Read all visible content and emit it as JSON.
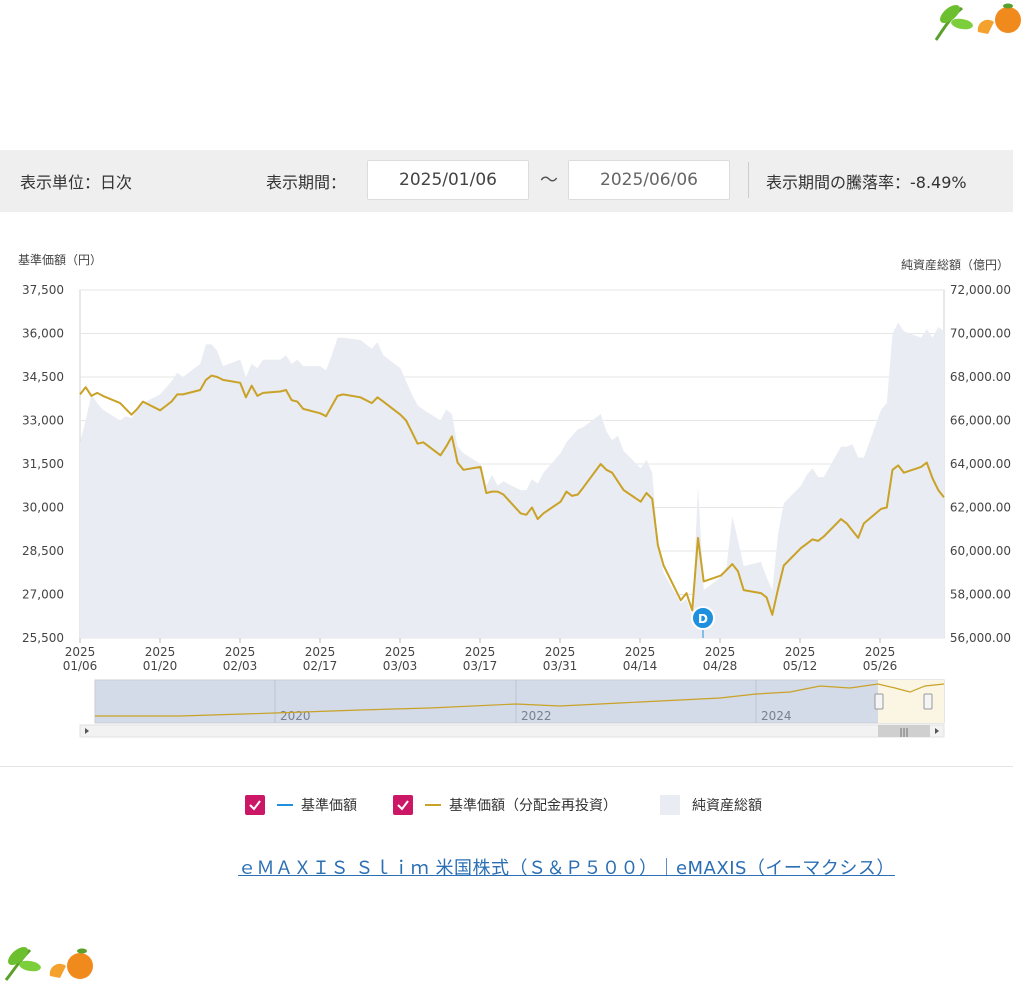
{
  "filter": {
    "unit_label": "表示単位：日次",
    "period_label": "表示期間：",
    "start_date": "2025/01/06",
    "tilde": "～",
    "end_date": "2025/06/06",
    "change_label": "表示期間の騰落率：-8.49%"
  },
  "legend": {
    "item1": "基準価額",
    "item2": "基準価額（分配金再投資）",
    "item3": "純資産総額"
  },
  "footer_link": "ｅＭＡＸＩＳ Ｓｌｉｍ 米国株式（Ｓ＆Ｐ５００）｜eMAXIS（イーマクシス）",
  "chart_data": {
    "type": "line",
    "left_axis": {
      "title": "基準価額（円）",
      "range": [
        25500,
        37500
      ],
      "ticks": [
        "37,500",
        "36,000",
        "34,500",
        "33,000",
        "31,500",
        "30,000",
        "28,500",
        "27,000",
        "25,500"
      ]
    },
    "right_axis": {
      "title": "純資産総額（億円）",
      "range": [
        56000,
        72000
      ],
      "ticks": [
        "72,000.00",
        "70,000.00",
        "68,000.00",
        "66,000.00",
        "64,000.00",
        "62,000.00",
        "60,000.00",
        "58,000.00",
        "56,000.00"
      ]
    },
    "x_ticks": [
      [
        "2025",
        "01/06"
      ],
      [
        "2025",
        "01/20"
      ],
      [
        "2025",
        "02/03"
      ],
      [
        "2025",
        "02/17"
      ],
      [
        "2025",
        "03/03"
      ],
      [
        "2025",
        "03/17"
      ],
      [
        "2025",
        "03/31"
      ],
      [
        "2025",
        "04/14"
      ],
      [
        "2025",
        "04/28"
      ],
      [
        "2025",
        "05/12"
      ],
      [
        "2025",
        "05/26"
      ]
    ],
    "x_range": [
      "2025-01-06",
      "2025-06-06"
    ],
    "grid": true,
    "marker": "D",
    "colors": {
      "nav": "#1e90dd",
      "nav_reinvested": "#c9a227",
      "net_assets": "#e9ecf2"
    },
    "series": [
      {
        "name": "基準価額（分配金再投資）",
        "axis": "left",
        "points": [
          [
            "2025-01-06",
            33900
          ],
          [
            "2025-01-07",
            34150
          ],
          [
            "2025-01-08",
            33850
          ],
          [
            "2025-01-09",
            33950
          ],
          [
            "2025-01-10",
            33850
          ],
          [
            "2025-01-13",
            33600
          ],
          [
            "2025-01-14",
            33400
          ],
          [
            "2025-01-15",
            33200
          ],
          [
            "2025-01-16",
            33400
          ],
          [
            "2025-01-17",
            33650
          ],
          [
            "2025-01-20",
            33350
          ],
          [
            "2025-01-21",
            33500
          ],
          [
            "2025-01-22",
            33650
          ],
          [
            "2025-01-23",
            33900
          ],
          [
            "2025-01-24",
            33900
          ],
          [
            "2025-01-27",
            34050
          ],
          [
            "2025-01-28",
            34400
          ],
          [
            "2025-01-29",
            34550
          ],
          [
            "2025-01-30",
            34500
          ],
          [
            "2025-01-31",
            34400
          ],
          [
            "2025-02-03",
            34300
          ],
          [
            "2025-02-04",
            33800
          ],
          [
            "2025-02-05",
            34200
          ],
          [
            "2025-02-06",
            33850
          ],
          [
            "2025-02-07",
            33950
          ],
          [
            "2025-02-10",
            34000
          ],
          [
            "2025-02-11",
            34050
          ],
          [
            "2025-02-12",
            33700
          ],
          [
            "2025-02-13",
            33650
          ],
          [
            "2025-02-14",
            33400
          ],
          [
            "2025-02-17",
            33250
          ],
          [
            "2025-02-18",
            33150
          ],
          [
            "2025-02-19",
            33500
          ],
          [
            "2025-02-20",
            33850
          ],
          [
            "2025-02-21",
            33900
          ],
          [
            "2025-02-24",
            33800
          ],
          [
            "2025-02-25",
            33700
          ],
          [
            "2025-02-26",
            33600
          ],
          [
            "2025-02-27",
            33800
          ],
          [
            "2025-02-28",
            33650
          ],
          [
            "2025-03-03",
            33200
          ],
          [
            "2025-03-04",
            33000
          ],
          [
            "2025-03-05",
            32600
          ],
          [
            "2025-03-06",
            32200
          ],
          [
            "2025-03-07",
            32250
          ],
          [
            "2025-03-10",
            31800
          ],
          [
            "2025-03-11",
            32100
          ],
          [
            "2025-03-12",
            32450
          ],
          [
            "2025-03-13",
            31550
          ],
          [
            "2025-03-14",
            31300
          ],
          [
            "2025-03-17",
            31400
          ],
          [
            "2025-03-18",
            30500
          ],
          [
            "2025-03-19",
            30550
          ],
          [
            "2025-03-20",
            30550
          ],
          [
            "2025-03-21",
            30450
          ],
          [
            "2025-03-24",
            29800
          ],
          [
            "2025-03-25",
            29750
          ],
          [
            "2025-03-26",
            30000
          ],
          [
            "2025-03-27",
            29600
          ],
          [
            "2025-03-28",
            29800
          ],
          [
            "2025-03-31",
            30200
          ],
          [
            "2025-04-01",
            30550
          ],
          [
            "2025-04-02",
            30400
          ],
          [
            "2025-04-03",
            30450
          ],
          [
            "2025-04-04",
            30700
          ],
          [
            "2025-04-07",
            31500
          ],
          [
            "2025-04-08",
            31300
          ],
          [
            "2025-04-09",
            31200
          ],
          [
            "2025-04-10",
            30900
          ],
          [
            "2025-04-11",
            30600
          ],
          [
            "2025-04-14",
            30200
          ],
          [
            "2025-04-15",
            30500
          ],
          [
            "2025-04-16",
            30300
          ],
          [
            "2025-04-17",
            28700
          ],
          [
            "2025-04-18",
            28000
          ],
          [
            "2025-04-21",
            26800
          ],
          [
            "2025-04-22",
            27050
          ],
          [
            "2025-04-23",
            26450
          ],
          [
            "2025-04-24",
            28950
          ],
          [
            "2025-04-25",
            27450
          ],
          [
            "2025-04-28",
            27650
          ],
          [
            "2025-04-29",
            27850
          ],
          [
            "2025-04-30",
            28050
          ],
          [
            "2025-05-01",
            27800
          ],
          [
            "2025-05-02",
            27150
          ],
          [
            "2025-05-05",
            27050
          ],
          [
            "2025-05-06",
            26900
          ],
          [
            "2025-05-07",
            26300
          ],
          [
            "2025-05-08",
            27200
          ],
          [
            "2025-05-09",
            28000
          ],
          [
            "2025-05-12",
            28600
          ],
          [
            "2025-05-13",
            28750
          ],
          [
            "2025-05-14",
            28900
          ],
          [
            "2025-05-15",
            28850
          ],
          [
            "2025-05-16",
            29000
          ],
          [
            "2025-05-19",
            29600
          ],
          [
            "2025-05-20",
            29450
          ],
          [
            "2025-05-21",
            29200
          ],
          [
            "2025-05-22",
            28950
          ],
          [
            "2025-05-23",
            29450
          ],
          [
            "2025-05-26",
            29950
          ],
          [
            "2025-05-27",
            30000
          ],
          [
            "2025-05-28",
            31300
          ],
          [
            "2025-05-29",
            31450
          ],
          [
            "2025-05-30",
            31200
          ],
          [
            "2025-06-02",
            31400
          ],
          [
            "2025-06-03",
            31550
          ],
          [
            "2025-06-04",
            31000
          ],
          [
            "2025-06-05",
            30600
          ],
          [
            "2025-06-06",
            30350
          ]
        ]
      },
      {
        "name": "純資産総額",
        "axis": "right",
        "points": [
          [
            "2025-01-06",
            65000
          ],
          [
            "2025-01-07",
            66000
          ],
          [
            "2025-01-08",
            67200
          ],
          [
            "2025-01-09",
            66800
          ],
          [
            "2025-01-10",
            66500
          ],
          [
            "2025-01-13",
            66000
          ],
          [
            "2025-01-14",
            66200
          ],
          [
            "2025-01-15",
            66100
          ],
          [
            "2025-01-16",
            66500
          ],
          [
            "2025-01-17",
            66800
          ],
          [
            "2025-01-20",
            67200
          ],
          [
            "2025-01-21",
            67500
          ],
          [
            "2025-01-22",
            67800
          ],
          [
            "2025-01-23",
            68200
          ],
          [
            "2025-01-24",
            68000
          ],
          [
            "2025-01-27",
            68600
          ],
          [
            "2025-01-28",
            69500
          ],
          [
            "2025-01-29",
            69500
          ],
          [
            "2025-01-30",
            69200
          ],
          [
            "2025-01-31",
            68500
          ],
          [
            "2025-02-03",
            68800
          ],
          [
            "2025-02-04",
            68000
          ],
          [
            "2025-02-05",
            68600
          ],
          [
            "2025-02-06",
            68400
          ],
          [
            "2025-02-07",
            68800
          ],
          [
            "2025-02-10",
            68800
          ],
          [
            "2025-02-11",
            69000
          ],
          [
            "2025-02-12",
            68600
          ],
          [
            "2025-02-13",
            68800
          ],
          [
            "2025-02-14",
            68500
          ],
          [
            "2025-02-17",
            68500
          ],
          [
            "2025-02-18",
            68300
          ],
          [
            "2025-02-19",
            69000
          ],
          [
            "2025-02-20",
            69800
          ],
          [
            "2025-02-21",
            69800
          ],
          [
            "2025-02-24",
            69700
          ],
          [
            "2025-02-25",
            69500
          ],
          [
            "2025-02-26",
            69300
          ],
          [
            "2025-02-27",
            69600
          ],
          [
            "2025-02-28",
            69000
          ],
          [
            "2025-03-03",
            68400
          ],
          [
            "2025-03-04",
            67800
          ],
          [
            "2025-03-05",
            67200
          ],
          [
            "2025-03-06",
            66700
          ],
          [
            "2025-03-07",
            66500
          ],
          [
            "2025-03-10",
            66000
          ],
          [
            "2025-03-11",
            66500
          ],
          [
            "2025-03-12",
            66300
          ],
          [
            "2025-03-13",
            64800
          ],
          [
            "2025-03-14",
            64500
          ],
          [
            "2025-03-17",
            64000
          ],
          [
            "2025-03-18",
            63000
          ],
          [
            "2025-03-19",
            63500
          ],
          [
            "2025-03-20",
            63000
          ],
          [
            "2025-03-21",
            63200
          ],
          [
            "2025-03-24",
            62800
          ],
          [
            "2025-03-25",
            62800
          ],
          [
            "2025-03-26",
            63300
          ],
          [
            "2025-03-27",
            63100
          ],
          [
            "2025-03-28",
            63600
          ],
          [
            "2025-03-31",
            64500
          ],
          [
            "2025-04-01",
            65000
          ],
          [
            "2025-04-02",
            65300
          ],
          [
            "2025-04-03",
            65600
          ],
          [
            "2025-04-04",
            65700
          ],
          [
            "2025-04-07",
            66300
          ],
          [
            "2025-04-08",
            65500
          ],
          [
            "2025-04-09",
            65100
          ],
          [
            "2025-04-10",
            65300
          ],
          [
            "2025-04-11",
            64600
          ],
          [
            "2025-04-14",
            63800
          ],
          [
            "2025-04-15",
            64200
          ],
          [
            "2025-04-16",
            63600
          ],
          [
            "2025-04-17",
            60300
          ],
          [
            "2025-04-18",
            59000
          ],
          [
            "2025-04-21",
            57600
          ],
          [
            "2025-04-22",
            57800
          ],
          [
            "2025-04-23",
            57000
          ],
          [
            "2025-04-24",
            63000
          ],
          [
            "2025-04-25",
            58200
          ],
          [
            "2025-04-28",
            58800
          ],
          [
            "2025-04-29",
            59300
          ],
          [
            "2025-04-30",
            61600
          ],
          [
            "2025-05-01",
            60500
          ],
          [
            "2025-05-02",
            59300
          ],
          [
            "2025-05-05",
            59500
          ],
          [
            "2025-05-06",
            58800
          ],
          [
            "2025-05-07",
            58200
          ],
          [
            "2025-05-08",
            60800
          ],
          [
            "2025-05-09",
            62200
          ],
          [
            "2025-05-12",
            63000
          ],
          [
            "2025-05-13",
            63500
          ],
          [
            "2025-05-14",
            63800
          ],
          [
            "2025-05-15",
            63400
          ],
          [
            "2025-05-16",
            63400
          ],
          [
            "2025-05-19",
            64800
          ],
          [
            "2025-05-20",
            64800
          ],
          [
            "2025-05-21",
            64900
          ],
          [
            "2025-05-22",
            64300
          ],
          [
            "2025-05-23",
            64300
          ],
          [
            "2025-05-26",
            66500
          ],
          [
            "2025-05-27",
            66800
          ],
          [
            "2025-05-28",
            70000
          ],
          [
            "2025-05-29",
            70500
          ],
          [
            "2025-05-30",
            70100
          ],
          [
            "2025-06-02",
            69800
          ],
          [
            "2025-06-03",
            70200
          ],
          [
            "2025-06-04",
            69800
          ],
          [
            "2025-06-05",
            70300
          ],
          [
            "2025-06-06",
            70100
          ]
        ]
      }
    ],
    "navigator": {
      "labels": [
        "2020",
        "2022",
        "2024"
      ]
    }
  }
}
